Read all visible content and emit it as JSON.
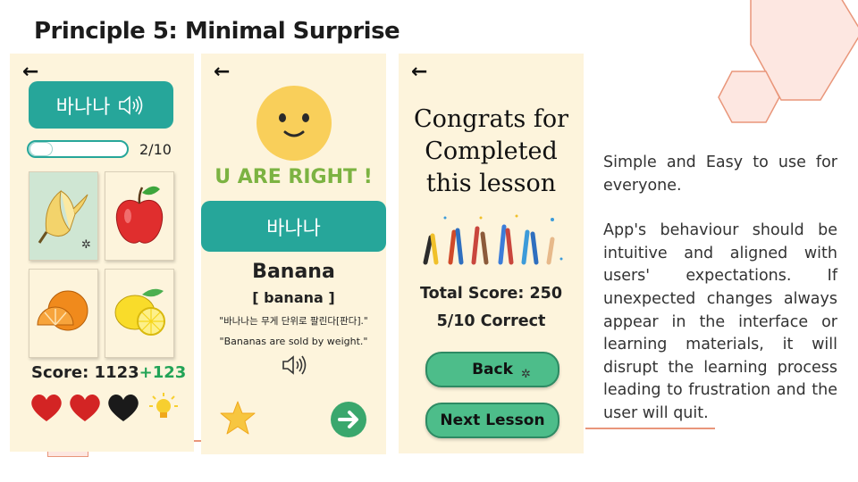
{
  "slide": {
    "title": "Principle 5: Minimal Surprise",
    "description": [
      "Simple and Easy to use for everyone.",
      "App's behaviour should be intuitive and aligned with users' expectations. If unexpected changes always appear in the interface or learning materials, it will disrupt the learning process leading to frustration and the user will quit."
    ]
  },
  "screen1": {
    "back_icon": "←",
    "word": "바나나",
    "speaker_icon": "speaker-icon",
    "progress": {
      "percent_label": "20%",
      "fraction": 0.2,
      "count": "2/10"
    },
    "cards": [
      "banana",
      "apple",
      "orange",
      "lemon"
    ],
    "selected_card": "banana",
    "score_label": "Score: 1123",
    "score_bonus": "+123",
    "hearts": [
      "red",
      "red",
      "black"
    ]
  },
  "screen2": {
    "back_icon": "←",
    "feedback": "U ARE RIGHT !",
    "word": "바나나",
    "translation": "Banana",
    "pronunciation": "[ banana ]",
    "example_korean": "\"바나나는 무게 단위로 팔린다[판다].\"",
    "example_english": "\"Bananas are sold by weight.\""
  },
  "screen3": {
    "back_icon": "←",
    "congrats": [
      "Congrats for",
      "Completed",
      "this lesson"
    ],
    "total_score": "Total Score: 250",
    "correct": "5/10 Correct",
    "back_button": "Back",
    "next_button": "Next Lesson"
  },
  "colors": {
    "teal": "#26a69a",
    "screen_bg": "#fdf4dc",
    "green_text": "#7cb342",
    "bonus_green": "#22a356",
    "hex_fill": "#fde7e1",
    "hex_stroke": "#e9967a"
  }
}
